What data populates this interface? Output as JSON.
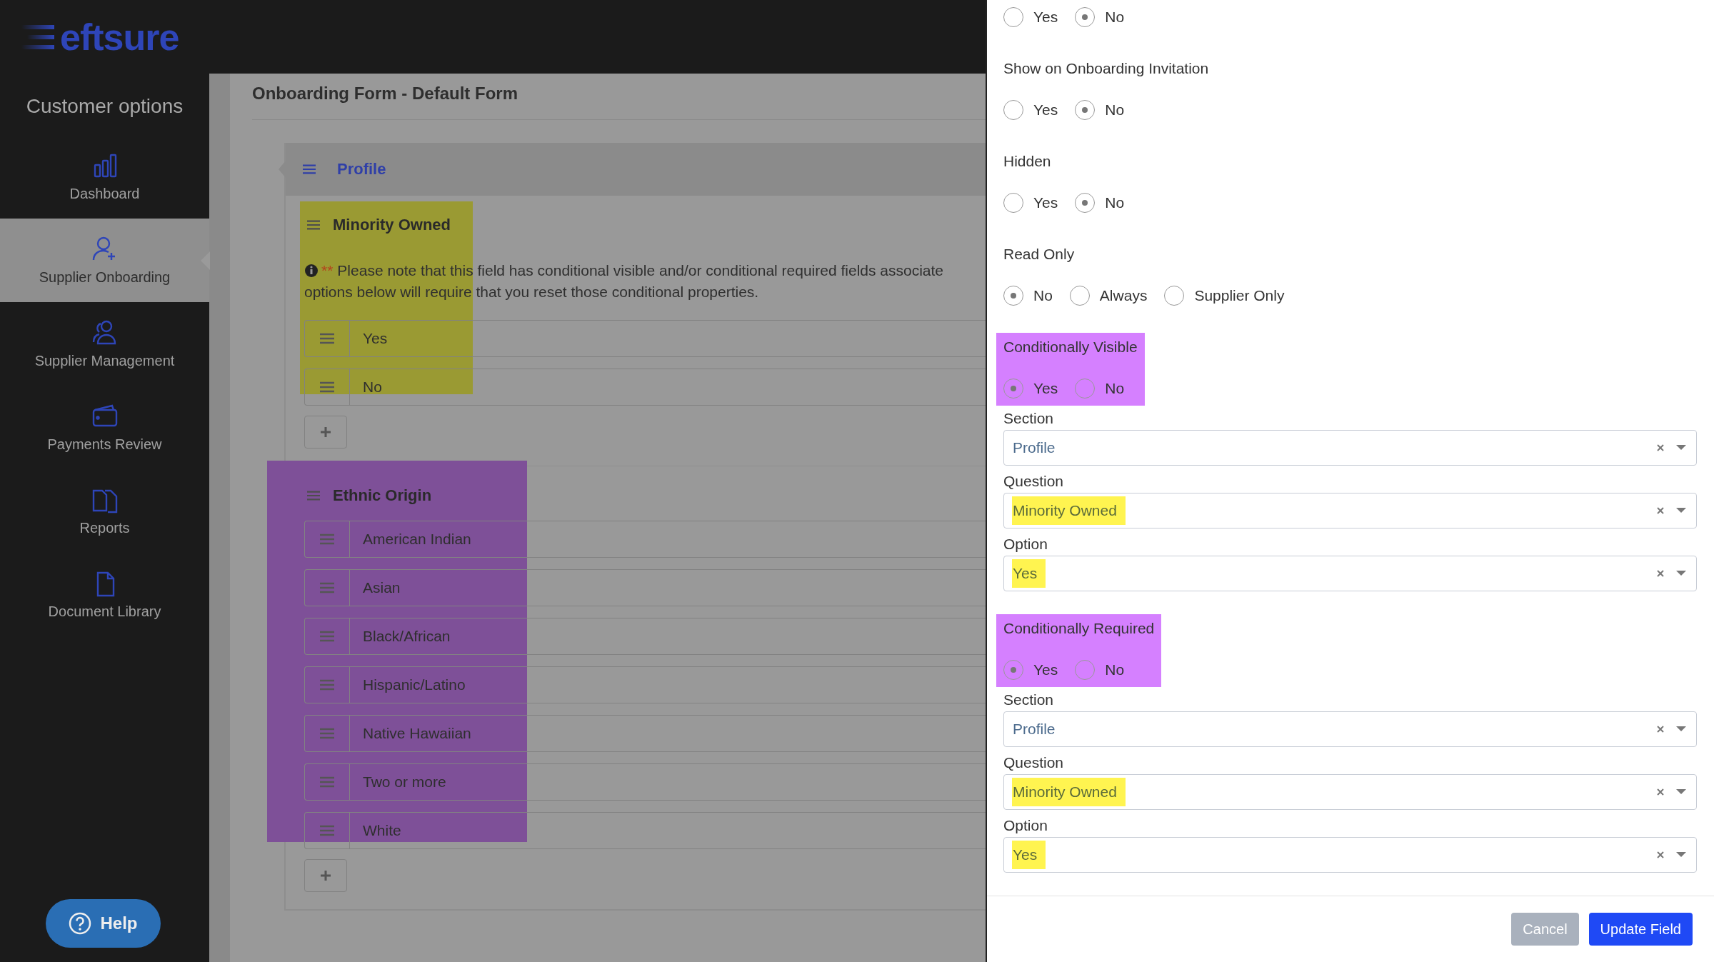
{
  "brand": {
    "logo_text": "eftsure"
  },
  "sidebar": {
    "title": "Customer options",
    "items": [
      {
        "label": "Dashboard",
        "selected": false
      },
      {
        "label": "Supplier Onboarding",
        "selected": true
      },
      {
        "label": "Supplier Management",
        "selected": false
      },
      {
        "label": "Payments Review",
        "selected": false
      },
      {
        "label": "Reports",
        "selected": false
      },
      {
        "label": "Document Library",
        "selected": false
      }
    ],
    "help_button": "Help"
  },
  "page_title": "Onboarding Form - Default Form",
  "section": {
    "title": "Profile",
    "questions": [
      {
        "title": "Minority Owned",
        "color": "#9a9a33",
        "note_marker": "**",
        "note_lines": [
          "Please note that this field has conditional visible and/or conditional required fields associate",
          "options below will require that you reset those conditional properties."
        ],
        "options": [
          "Yes",
          "No"
        ]
      },
      {
        "title": "Ethnic Origin",
        "color": "#7e5098",
        "options": [
          "American Indian",
          "Asian",
          "Black/African",
          "Hispanic/Latino",
          "Native Hawaiian",
          "Two or more",
          "White"
        ]
      }
    ]
  },
  "panel": {
    "fields": [
      {
        "kind": "radio",
        "options": [
          {
            "label": "Yes",
            "selected": false
          },
          {
            "label": "No",
            "selected": true
          }
        ]
      },
      {
        "kind": "radio",
        "label": "Show on Onboarding Invitation",
        "options": [
          {
            "label": "Yes",
            "selected": false
          },
          {
            "label": "No",
            "selected": true
          }
        ]
      },
      {
        "kind": "radio",
        "label": "Hidden",
        "options": [
          {
            "label": "Yes",
            "selected": false
          },
          {
            "label": "No",
            "selected": true
          }
        ]
      },
      {
        "kind": "radio",
        "label": "Read Only",
        "options": [
          {
            "label": "No",
            "selected": true
          },
          {
            "label": "Always",
            "selected": false
          },
          {
            "label": "Supplier Only",
            "selected": false
          }
        ]
      },
      {
        "kind": "radio",
        "label": "Conditionally Visible",
        "color": "#d580ff",
        "options": [
          {
            "label": "Yes",
            "selected": true
          },
          {
            "label": "No",
            "selected": false
          }
        ]
      },
      {
        "kind": "select",
        "label": "Section",
        "value": "Profile"
      },
      {
        "kind": "select",
        "label": "Question",
        "value": "Minority Owned",
        "color": "#fff450"
      },
      {
        "kind": "select",
        "label": "Option",
        "value": "Yes",
        "color": "#fff450"
      },
      {
        "kind": "radio",
        "label": "Conditionally Required",
        "color": "#d580ff",
        "options": [
          {
            "label": "Yes",
            "selected": true
          },
          {
            "label": "No",
            "selected": false
          }
        ]
      },
      {
        "kind": "select",
        "label": "Section",
        "value": "Profile"
      },
      {
        "kind": "select",
        "label": "Question",
        "value": "Minority Owned",
        "color": "#fff450"
      },
      {
        "kind": "select",
        "label": "Option",
        "value": "Yes",
        "color": "#fff450"
      }
    ],
    "buttons": [
      {
        "label": "Cancel",
        "disabled": true
      },
      {
        "label": "Update Field",
        "disabled": false
      }
    ]
  }
}
